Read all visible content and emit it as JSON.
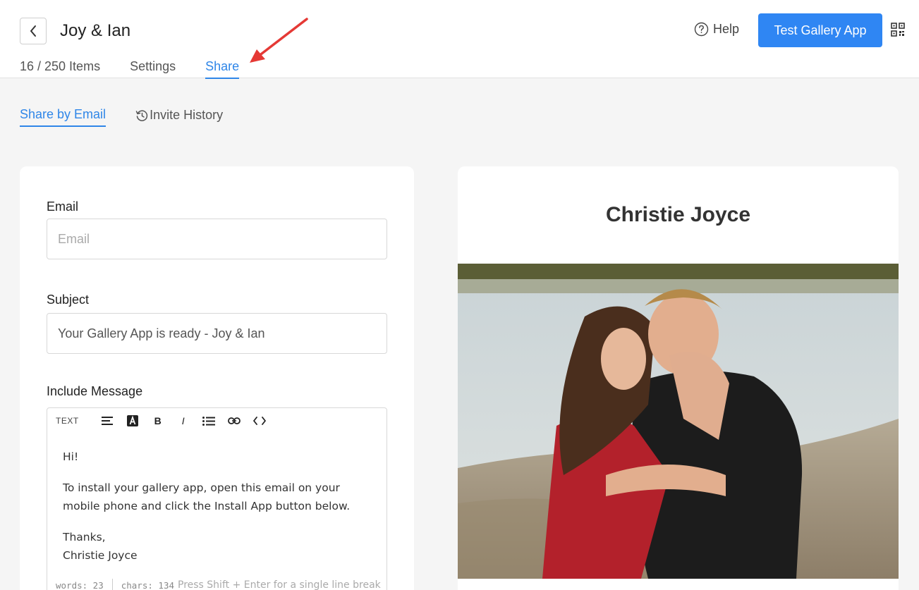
{
  "header": {
    "title": "Joy & Ian",
    "tabs": [
      {
        "label": "16 / 250 Items"
      },
      {
        "label": "Settings"
      },
      {
        "label": "Share"
      }
    ],
    "help_label": "Help",
    "test_button_label": "Test Gallery App"
  },
  "subtabs": [
    {
      "label": "Share by Email"
    },
    {
      "label": "Invite History"
    }
  ],
  "form": {
    "email_label": "Email",
    "email_placeholder": "Email",
    "subject_label": "Subject",
    "subject_value": "Your Gallery App is ready - Joy & Ian",
    "message_label": "Include Message",
    "toolbar": {
      "text_label": "TEXT"
    },
    "message": {
      "greeting": "Hi!",
      "body": "To install your gallery app, open this email on your mobile phone and click the Install App button below.",
      "signoff": "Thanks,",
      "signature": "Christie Joyce"
    },
    "footer": {
      "words": "words: 23",
      "chars": "chars: 134",
      "hint": "Press Shift + Enter for a single line break"
    }
  },
  "preview": {
    "title": "Christie Joyce"
  },
  "colors": {
    "accent": "#2f86e8",
    "button": "#2f86f3",
    "annotation_arrow": "#e53935"
  }
}
